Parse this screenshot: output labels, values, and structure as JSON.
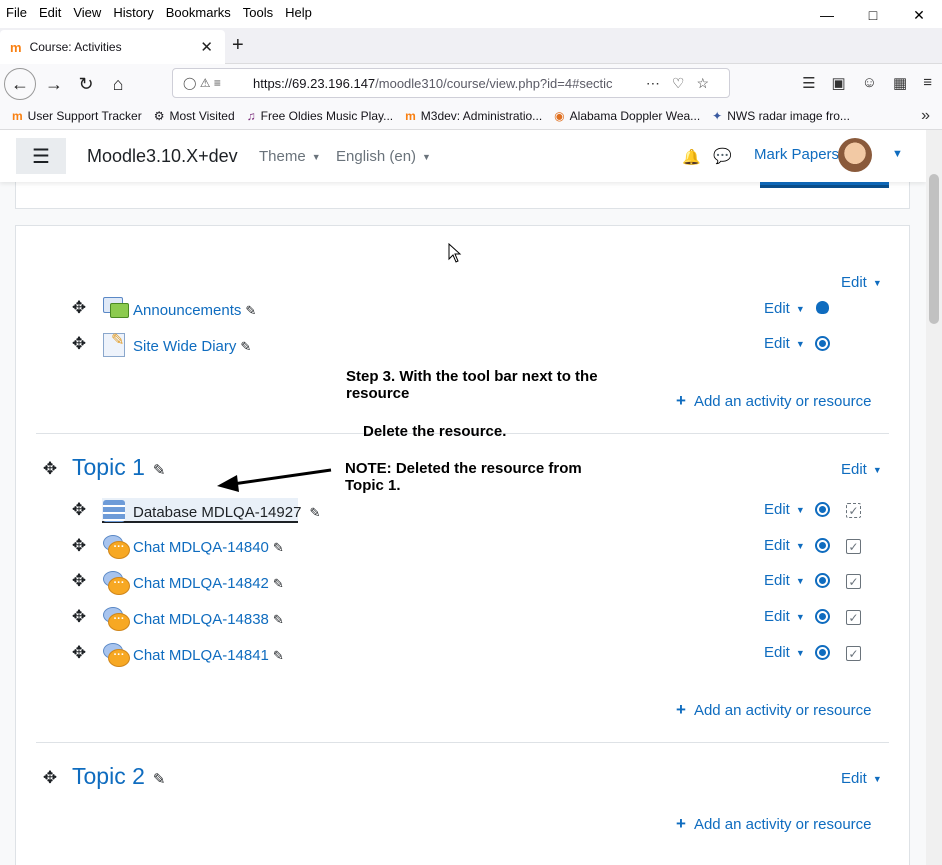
{
  "browser": {
    "menu": [
      "File",
      "Edit",
      "View",
      "History",
      "Bookmarks",
      "Tools",
      "Help"
    ],
    "tab_title": "Course: Activities",
    "url_host": "https://69.23.196.147",
    "url_path": "/moodle310/course/view.php?id=4#sectic",
    "bookmarks": [
      "User Support Tracker",
      "Most Visited",
      "Free Oldies Music Play...",
      "M3dev: Administratio...",
      "Alabama Doppler Wea...",
      "NWS radar image fro..."
    ]
  },
  "moodle": {
    "site_name": "Moodle3.10.X+dev",
    "theme_label": "Theme",
    "lang_label": "English (en)",
    "user_name": "Mark Papers"
  },
  "section0": {
    "edit": "Edit",
    "activities": [
      {
        "name": "Announcements",
        "edit": "Edit"
      },
      {
        "name": "Site Wide Diary",
        "edit": "Edit"
      }
    ],
    "add": "Add an activity or resource"
  },
  "topic1": {
    "title": "Topic 1",
    "edit": "Edit",
    "activities": [
      {
        "name": "Database MDLQA-14927",
        "edit": "Edit"
      },
      {
        "name": "Chat MDLQA-14840",
        "edit": "Edit"
      },
      {
        "name": "Chat MDLQA-14842",
        "edit": "Edit"
      },
      {
        "name": "Chat MDLQA-14838",
        "edit": "Edit"
      },
      {
        "name": "Chat MDLQA-14841",
        "edit": "Edit"
      }
    ],
    "add": "Add an activity or resource"
  },
  "topic2": {
    "title": "Topic 2",
    "edit": "Edit",
    "add": "Add an activity or resource"
  },
  "annotations": {
    "step3_line1": "Step 3. With the tool bar next to the",
    "step3_line2": "resource",
    "delete": "Delete the resource.",
    "note_line1": "NOTE: Deleted the resource from",
    "note_line2": "Topic 1."
  }
}
